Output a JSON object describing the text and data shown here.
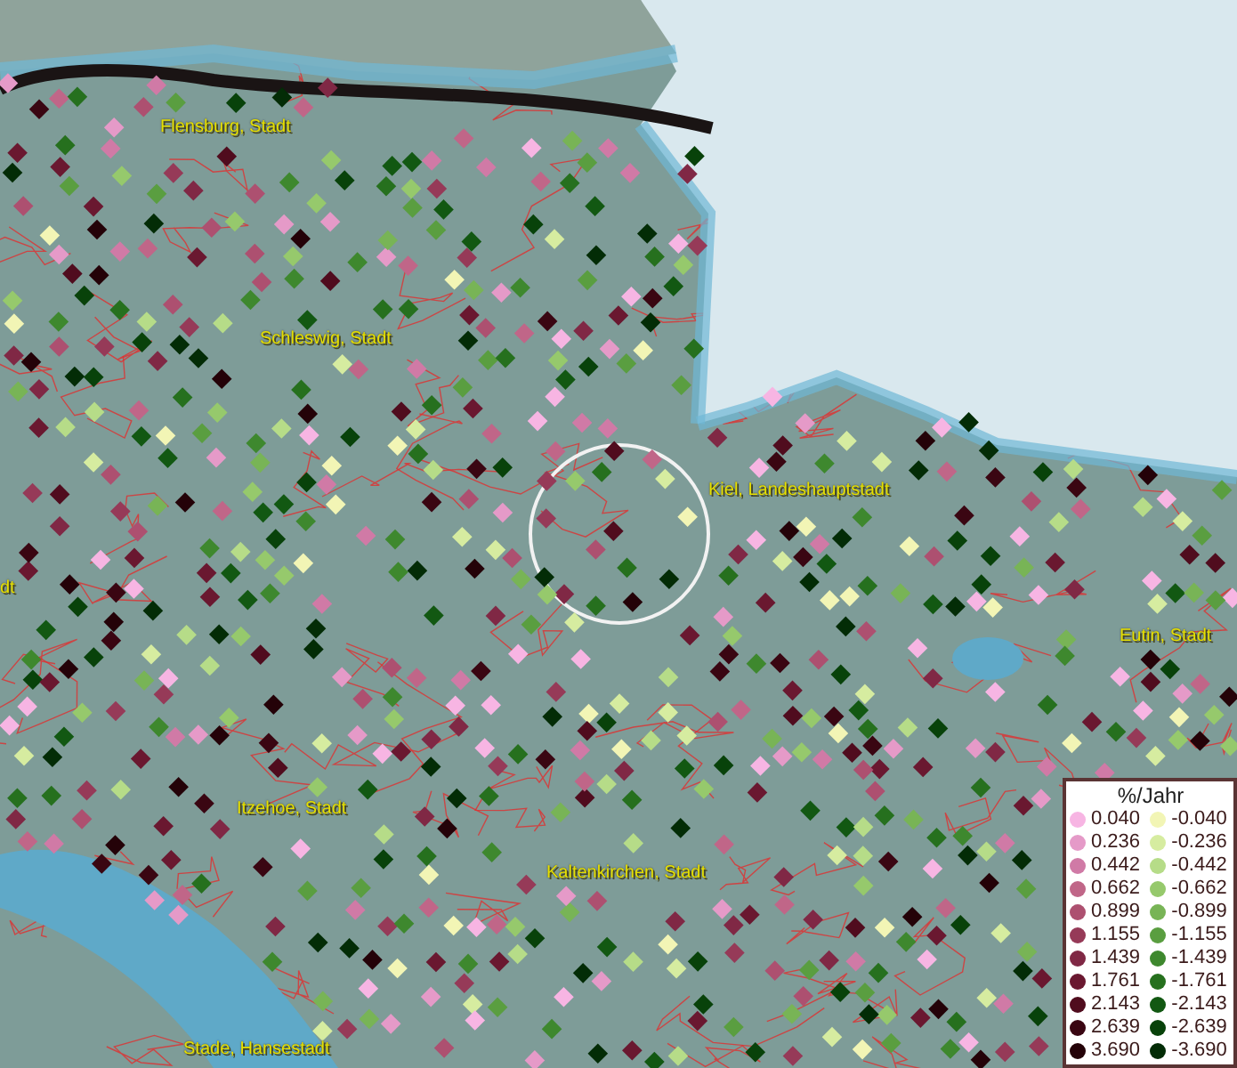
{
  "map": {
    "places": [
      {
        "name": "Flensburg, Stadt"
      },
      {
        "name": "Schleswig, Stadt"
      },
      {
        "name": "Kiel, Landeshauptstadt"
      },
      {
        "name": "dt"
      },
      {
        "name": "Eutin, Stadt"
      },
      {
        "name": "Itzehoe, Stadt"
      },
      {
        "name": "Kaltenkirchen, Stadt"
      },
      {
        "name": "Stade, Hansestadt"
      }
    ]
  },
  "legend": {
    "title": "%/Jahr",
    "positive": [
      {
        "value": "0.040",
        "color": "#f7b5e3"
      },
      {
        "value": "0.236",
        "color": "#e59ac8"
      },
      {
        "value": "0.442",
        "color": "#d07aa6"
      },
      {
        "value": "0.662",
        "color": "#c06688"
      },
      {
        "value": "0.899",
        "color": "#ad5070"
      },
      {
        "value": "1.155",
        "color": "#963a58"
      },
      {
        "value": "1.439",
        "color": "#802845"
      },
      {
        "value": "1.761",
        "color": "#6a1830"
      },
      {
        "value": "2.143",
        "color": "#500c1e"
      },
      {
        "value": "2.639",
        "color": "#3a0612"
      },
      {
        "value": "3.690",
        "color": "#240208"
      }
    ],
    "negative": [
      {
        "value": "-0.040",
        "color": "#f2f5b5"
      },
      {
        "value": "-0.236",
        "color": "#d6eca0"
      },
      {
        "value": "-0.442",
        "color": "#b6dc88"
      },
      {
        "value": "-0.662",
        "color": "#96c96c"
      },
      {
        "value": "-0.899",
        "color": "#78b456"
      },
      {
        "value": "-1.155",
        "color": "#5a9e40"
      },
      {
        "value": "-1.439",
        "color": "#3e882e"
      },
      {
        "value": "-1.761",
        "color": "#26701e"
      },
      {
        "value": "-2.143",
        "color": "#125812"
      },
      {
        "value": "-2.639",
        "color": "#08420a"
      },
      {
        "value": "-3.690",
        "color": "#032c06"
      }
    ]
  }
}
